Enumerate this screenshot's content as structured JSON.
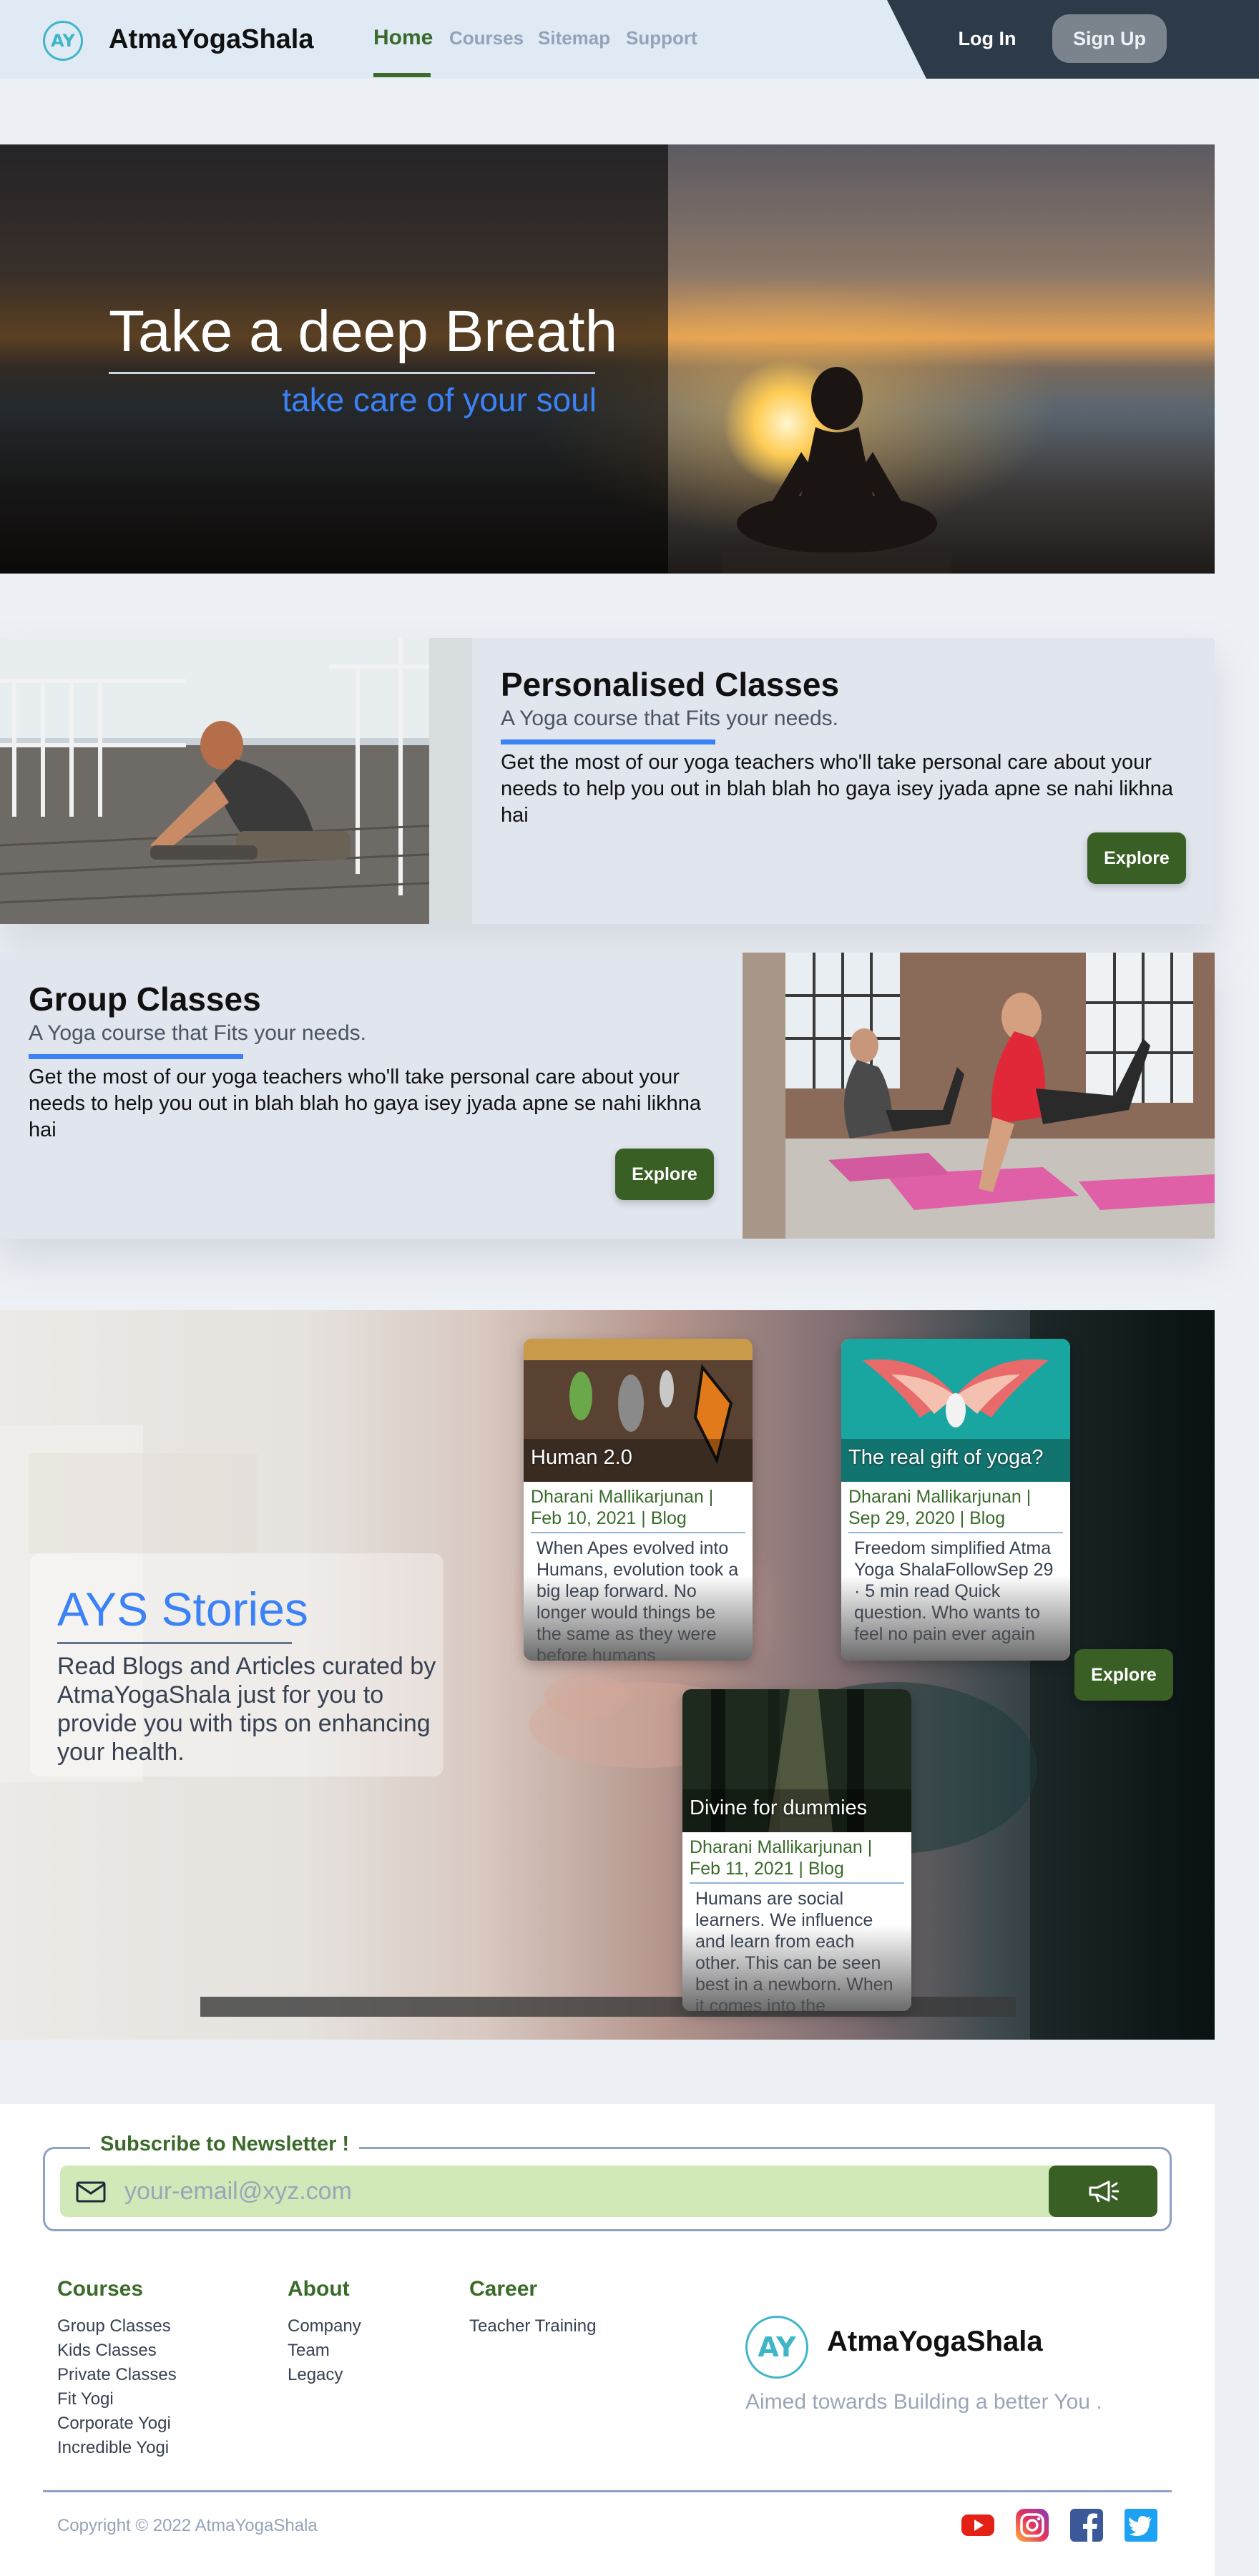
{
  "brand": {
    "logo_text": "AY",
    "name": "AtmaYogaShala"
  },
  "nav": {
    "links": [
      "Home",
      "Courses",
      "Sitemap",
      "Support"
    ],
    "active": "Home",
    "login": "Log In",
    "signup": "Sign Up"
  },
  "hero": {
    "title": "Take a deep Breath",
    "subtitle": "take care of your soul"
  },
  "classes": [
    {
      "title": "Personalised Classes",
      "subtitle": "A Yoga course that Fits your needs.",
      "description": "Get the most of our yoga teachers who'll take personal care about your needs to help you out in blah blah ho gaya isey jyada apne se nahi likhna hai",
      "button": "Explore"
    },
    {
      "title": "Group Classes",
      "subtitle": "A Yoga course that Fits your needs.",
      "description": "Get the most of our yoga teachers who'll take personal care about your needs to help you out in blah blah ho gaya isey jyada apne se nahi likhna hai",
      "button": "Explore"
    }
  ],
  "stories": {
    "title": "AYS Stories",
    "description": "Read Blogs and Articles curated by AtmaYogaShala just for you to provide you with tips on enhancing your health.",
    "button": "Explore",
    "posts": [
      {
        "title": "Human 2.0",
        "meta": "Dharani Mallikarjunan | Feb 10, 2021 | Blog",
        "excerpt": "When Apes evolved into Humans, evolution took a big leap forward. No longer would things be the same as they were before humans"
      },
      {
        "title": "The real gift of yoga?",
        "meta": "Dharani Mallikarjunan | Sep 29, 2020 | Blog",
        "excerpt": "Freedom simplified Atma Yoga ShalaFollowSep 29 · 5 min read Quick question. Who wants to feel no pain ever again"
      },
      {
        "title": "Divine for dummies",
        "meta": "Dharani Mallikarjunan | Feb 11, 2021 | Blog",
        "excerpt": "Humans are social learners. We influence and learn from each other. This can be seen best in a newborn. When it comes into the"
      }
    ]
  },
  "newsletter": {
    "label": "Subscribe to Newsletter !",
    "placeholder": "your-email@xyz.com"
  },
  "footer": {
    "courses": {
      "heading": "Courses",
      "items": [
        "Group Classes",
        "Kids Classes",
        "Private Classes",
        "Fit Yogi",
        "Corporate Yogi",
        "Incredible Yogi"
      ]
    },
    "about": {
      "heading": "About",
      "items": [
        "Company",
        "Team",
        "Legacy"
      ]
    },
    "career": {
      "heading": "Career",
      "items": [
        "Teacher Training"
      ]
    },
    "brand_name": "AtmaYogaShala",
    "tagline": "Aimed towards Building a better You .",
    "copyright": "Copyright © 2022 AtmaYogaShala"
  },
  "colors": {
    "accent_green": "#3a6b2a",
    "accent_blue": "#3b82f6",
    "logo_teal": "#3fb6c8"
  },
  "icons": [
    "mail-icon",
    "megaphone-icon",
    "youtube-icon",
    "instagram-icon",
    "facebook-icon",
    "twitter-icon"
  ]
}
